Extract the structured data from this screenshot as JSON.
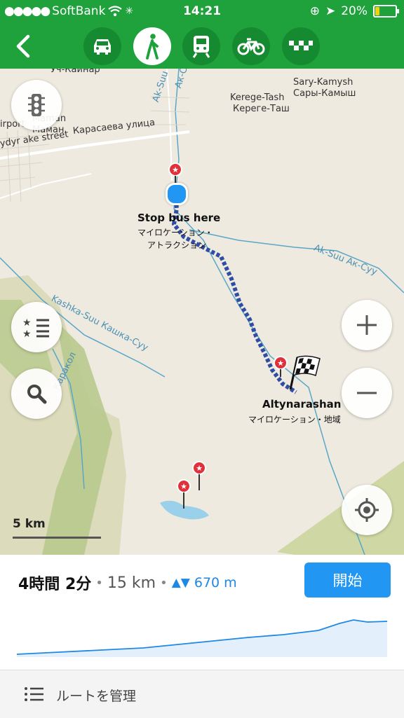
{
  "status": {
    "carrier": "SoftBank",
    "time": "14:21",
    "battery": "20%"
  },
  "modes": [
    {
      "name": "car-icon",
      "active": false
    },
    {
      "name": "walk-icon",
      "active": true
    },
    {
      "name": "train-icon",
      "active": false
    },
    {
      "name": "bike-icon",
      "active": false
    },
    {
      "name": "taxi-icon",
      "active": false
    }
  ],
  "map": {
    "labels": {
      "top_village": "Уч-Кайнар",
      "sary_kamysh_en": "Sary-Kamysh",
      "sary_kamysh_ru": "Сары-Камыш",
      "kerege_tash_en": "Kerege-Tash",
      "kerege_tash_ru": "Кереге-Таш",
      "maman_en": "Maman",
      "maman_ru": "Маман",
      "airport": "irport",
      "street_en": "ydyr ake street",
      "street_ru": "Карасаева улица",
      "river_aksuu": "Ak-Suu",
      "river_aksuu_ru": "Ак-Суу",
      "river_aksuu2": "Ak-Suu  Ак-Суу",
      "river_kashka": "Kashka-Suu  Кашка-Суу",
      "river_karakol": "Каракол"
    },
    "start": {
      "title": "Stop bus here",
      "subtitle_line1": "マイロケーション・",
      "subtitle_line2": "アトラクション"
    },
    "finish": {
      "title": "Altynarashan",
      "subtitle": "マイロケーション・地域"
    },
    "scale": "5 km"
  },
  "route": {
    "duration": "4時間 2分",
    "distance": "15 km",
    "elevation": "670 m",
    "start_button": "開始",
    "manage_label": "ルートを管理"
  }
}
